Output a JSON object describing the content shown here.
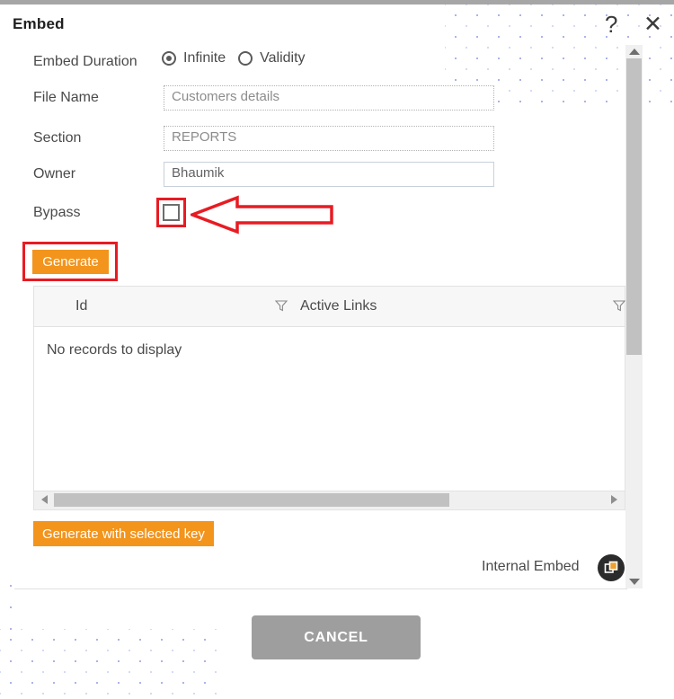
{
  "window": {
    "title": "Embed",
    "help_icon": "question-mark-icon",
    "close_icon": "close-icon"
  },
  "form": {
    "embed_duration": {
      "label": "Embed Duration",
      "options": [
        {
          "label": "Infinite",
          "selected": true
        },
        {
          "label": "Validity",
          "selected": false
        }
      ]
    },
    "file_name": {
      "label": "File Name",
      "value": "Customers details"
    },
    "section": {
      "label": "Section",
      "value": "REPORTS"
    },
    "owner": {
      "label": "Owner",
      "value": "Bhaumik"
    },
    "bypass": {
      "label": "Bypass",
      "checked": false
    }
  },
  "buttons": {
    "generate": "Generate",
    "generate_with_selected_key": "Generate with selected key",
    "cancel": "CANCEL"
  },
  "grid": {
    "columns": [
      "Id",
      "Active Links"
    ],
    "rows": [],
    "empty_message": "No records to display"
  },
  "footer": {
    "internal_embed_label": "Internal Embed",
    "copy_icon": "copy-icon"
  },
  "colors": {
    "accent_orange": "#f3941c",
    "highlight_red": "#e81b23",
    "cancel_gray": "#9e9e9e",
    "scrollbar_thumb": "#c1c1c1"
  }
}
